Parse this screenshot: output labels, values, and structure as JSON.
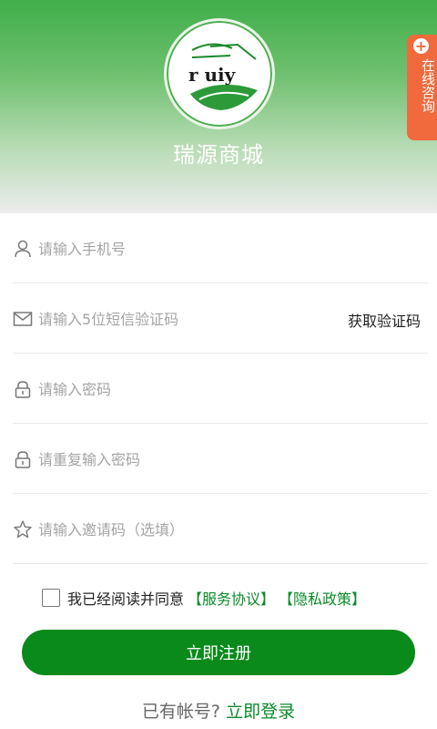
{
  "header": {
    "brand_name": "瑞源商城",
    "logo_text": "r uiy"
  },
  "consult_tab": {
    "label": "在线咨询"
  },
  "form": {
    "phone_placeholder": "请输入手机号",
    "sms_placeholder": "请输入5位短信验证码",
    "get_code_label": "获取验证码",
    "password_placeholder": "请输入密码",
    "repeat_password_placeholder": "请重复输入密码",
    "invite_placeholder": "请输入邀请码（选填）"
  },
  "agreement": {
    "text": "我已经阅读并同意",
    "service_link": "【服务协议】",
    "privacy_link": "【隐私政策】"
  },
  "register_button": "立即注册",
  "login_prompt": {
    "text": "已有帐号?",
    "link": "立即登录"
  },
  "colors": {
    "primary_green": "#098a1a",
    "link_green": "#0b8a2a",
    "consult_orange": "#f06a3d"
  },
  "icons": [
    "user-icon",
    "mail-icon",
    "lock-icon",
    "star-icon",
    "plus-icon"
  ]
}
